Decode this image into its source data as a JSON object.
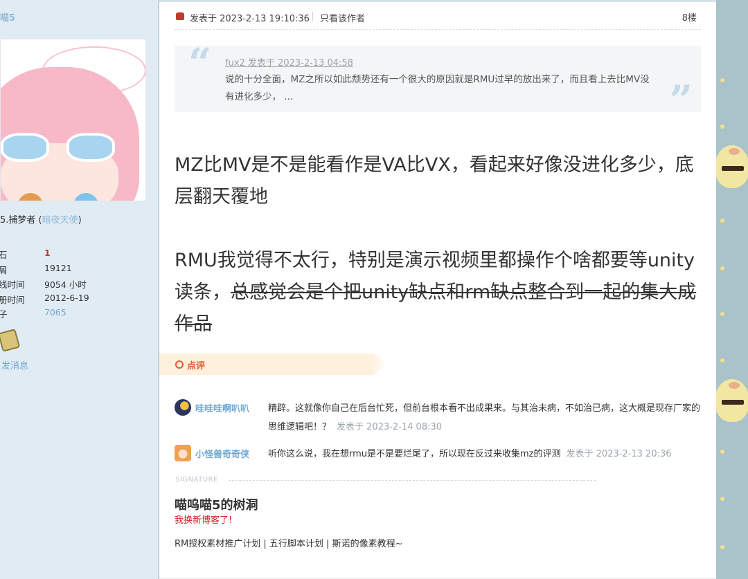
{
  "sidebar": {
    "username_fragment": "喵5",
    "rank_text": "5.捕梦者 (",
    "group": "暗夜天使",
    "rank_close": ")",
    "stats": [
      {
        "key": "石",
        "value": "1",
        "style": "red"
      },
      {
        "key": "屑",
        "value": "19121",
        "style": "plain"
      },
      {
        "key": "线时间",
        "value": "9054 小时",
        "style": "plain"
      },
      {
        "key": "册时间",
        "value": "2012-6-19",
        "style": "plain"
      },
      {
        "key": "子",
        "value": "7065",
        "style": "blue"
      }
    ],
    "send_message": "发消息"
  },
  "post": {
    "posted_at": "发表于 2023-2-13 19:10:36",
    "only_author": "只看该作者",
    "floor": "8楼",
    "quote": {
      "meta": "fux2 发表于 2023-2-13 04:58",
      "text": "说的十分全面，MZ之所以如此颓势还有一个很大的原因就是RMU过早的放出来了，而且看上去比MV没有进化多少， ..."
    },
    "body": {
      "p1": "MZ比MV是不是能看作是VA比VX，看起来好像没进化多少，底层翻天覆地",
      "p2_normal": "RMU我觉得不太行，特别是演示视频里都操作个啥都要等unity读条，",
      "p2_strike": "总感觉会是个把unity缺点和rm缺点整合到一起的集大成作品"
    }
  },
  "reviews": {
    "label": "点评",
    "items": [
      {
        "name": "哇哇哇啊叭叭",
        "text": "精辟。这就像你自己在后台忙死，但前台根本看不出成果来。与其治未病，不如治已病，这大概是现存厂家的思维逻辑吧！？",
        "time": "发表于 2023-2-14 08:30"
      },
      {
        "name": "小怪兽奇奇侠",
        "text": "听你这么说，我在想rmu是不是要烂尾了，所以现在反过来收集mz的评测",
        "time": "发表于 2023-2-13 20:36"
      }
    ]
  },
  "signature": {
    "label": "SIGNATURE",
    "title": "喵呜喵5的树洞",
    "subtitle": "我换新博客了!",
    "links": [
      "RM授权素材推广计划",
      "五行脚本计划",
      "斯诺的像素教程~"
    ],
    "link_sep": " | "
  },
  "colors": {
    "accent_blue": "#6fa8d6",
    "review_orange": "#e5582f",
    "signature_red": "#d6232a",
    "sidebar_bg": "#e1ebf3"
  }
}
